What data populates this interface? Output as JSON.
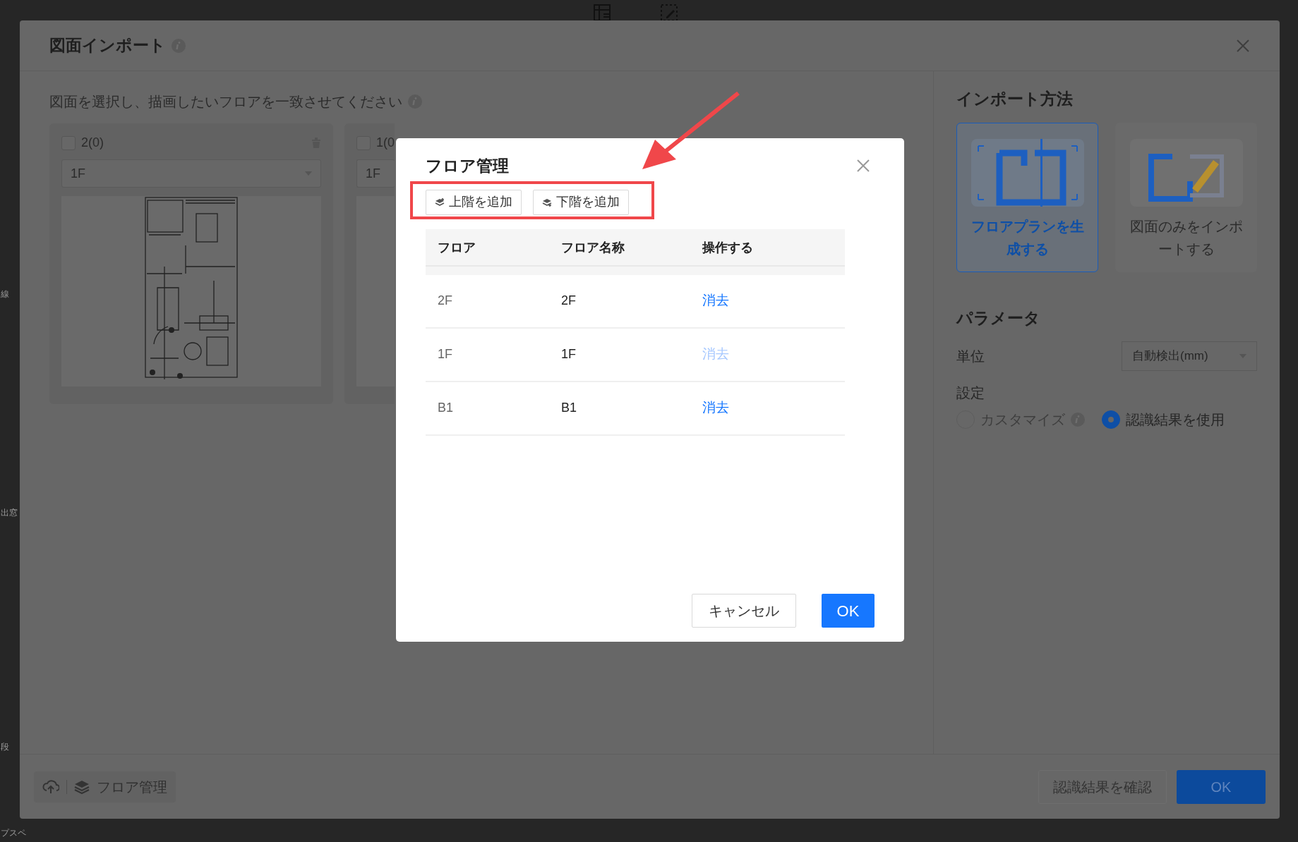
{
  "side_labels": [
    "線",
    "出窓",
    "段",
    "プスペ"
  ],
  "import_dialog": {
    "title": "図面インポート",
    "instruction": "図面を選択し、描画したいフロアを一致させてください",
    "drawings": [
      {
        "label": "2(0)",
        "checked": false,
        "floor": "1F",
        "kind": "full"
      },
      {
        "label": "1(0",
        "checked": false,
        "floor": "1F",
        "kind": "partial"
      }
    ],
    "import_method": {
      "heading": "インポート方法",
      "options": [
        {
          "label": "フロアプランを生成する",
          "selected": true,
          "kind": "generate"
        },
        {
          "label": "図面のみをインポートする",
          "selected": false,
          "kind": "import"
        }
      ]
    },
    "parameters": {
      "heading": "パラメータ",
      "unit_label": "単位",
      "unit_value": "自動検出(mm)",
      "setting_label": "設定",
      "options": [
        {
          "label": "カスタマイズ",
          "selected": false,
          "info": true
        },
        {
          "label": "認識結果を使用",
          "selected": true,
          "info": false
        }
      ]
    },
    "footer": {
      "floor_button": "フロア管理",
      "confirm_button": "認識結果を確認",
      "ok_button": "OK"
    }
  },
  "floor_dialog": {
    "title": "フロア管理",
    "toolbar": [
      {
        "label": "上階を追加",
        "kind": "up"
      },
      {
        "label": "下階を追加",
        "kind": "down"
      }
    ],
    "columns": [
      "フロア",
      "フロア名称",
      "操作する"
    ],
    "rows": [
      {
        "floor": "2F",
        "name": "2F",
        "action": "消去",
        "disabled": false
      },
      {
        "floor": "1F",
        "name": "1F",
        "action": "消去",
        "disabled": true
      },
      {
        "floor": "B1",
        "name": "B1",
        "action": "消去",
        "disabled": false
      }
    ],
    "cancel_button": "キャンセル",
    "ok_button": "OK"
  }
}
